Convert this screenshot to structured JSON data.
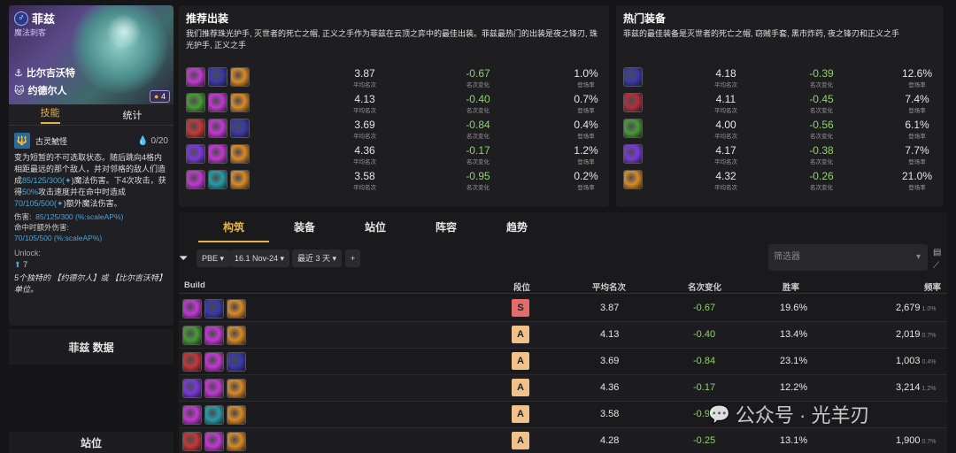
{
  "hero": {
    "name": "菲兹",
    "role": "魔法刺客",
    "trait1": "比尔吉沃特",
    "trait2": "约德尔人",
    "cost": "4"
  },
  "left_tabs": {
    "skill": "技能",
    "stats": "统计"
  },
  "skill": {
    "name": "古灵鯱怪",
    "mana": "0/20",
    "desc_part1": "变为短暂的不可选取状态。随后跳向4格内相距最远的那个敌人，并对邻格的敌人们造成",
    "desc_val1": "85/125/300(",
    "desc_part2": ")魔法伤害。下4次攻击，获得",
    "desc_val2": "50%",
    "desc_part3": "攻击速度并在命中时造成",
    "desc_val3": "70/105/500(",
    "desc_part4": ")额外魔法伤害。",
    "dmg_label": "伤害:",
    "dmg_val": "85/125/300 (%:scaleAP%)",
    "extra_label": "命中时额外伤害:",
    "extra_val": "70/105/500 (%:scaleAP%)",
    "unlock_label": "Unlock:",
    "unlock_count": "7",
    "unlock_desc": "5个独特的 【约德尔人】或 【比尔吉沃特】单位。"
  },
  "left_blocks": {
    "data": "菲兹 数据",
    "position": "站位"
  },
  "recommend": {
    "title": "推荐出装",
    "intro": "我们推荐珠光护手, 灭世者的死亡之帽, 正义之手作为菲兹在云顶之弈中的最佳出装。菲兹最热门的出装是夜之锋刃, 珠光护手, 正义之手",
    "sub_avg": "平均名次",
    "sub_change": "名次变化",
    "sub_rate": "登场率",
    "rows": [
      {
        "avg": "3.87",
        "change": "-0.67",
        "rate": "1.0%",
        "items": [
          "#c03ad0",
          "#3a3aa8",
          "#d88a2a"
        ]
      },
      {
        "avg": "4.13",
        "change": "-0.40",
        "rate": "0.7%",
        "items": [
          "#4a9a3a",
          "#c03ad0",
          "#d88a2a"
        ]
      },
      {
        "avg": "3.69",
        "change": "-0.84",
        "rate": "0.4%",
        "items": [
          "#c23a3a",
          "#c03ad0",
          "#3a3aa8"
        ]
      },
      {
        "avg": "4.36",
        "change": "-0.17",
        "rate": "1.2%",
        "items": [
          "#7a3ad8",
          "#c03ad0",
          "#d88a2a"
        ]
      },
      {
        "avg": "3.58",
        "change": "-0.95",
        "rate": "0.2%",
        "items": [
          "#c03ad0",
          "#2a9aa8",
          "#d88a2a"
        ]
      }
    ]
  },
  "hot": {
    "title": "热门装备",
    "intro": "菲兹的最佳装备是灭世者的死亡之帽, 窃贼手套, 黑市炸药, 夜之锋刃和正义之手",
    "rows": [
      {
        "avg": "4.18",
        "change": "-0.39",
        "rate": "12.6%",
        "color": "#3a3aa8"
      },
      {
        "avg": "4.11",
        "change": "-0.45",
        "rate": "7.4%",
        "color": "#b03040"
      },
      {
        "avg": "4.00",
        "change": "-0.56",
        "rate": "6.1%",
        "color": "#4a9a3a"
      },
      {
        "avg": "4.17",
        "change": "-0.38",
        "rate": "7.7%",
        "color": "#7a3ad8"
      },
      {
        "avg": "4.32",
        "change": "-0.26",
        "rate": "21.0%",
        "color": "#d88a2a"
      }
    ]
  },
  "bottom_tabs": [
    "构筑",
    "装备",
    "站位",
    "阵容",
    "趋势"
  ],
  "filters": {
    "server": "PBE",
    "patch": "16.1 Nov-24",
    "days": "最近 3 天",
    "add": "+",
    "search_placeholder": "筛选器"
  },
  "table": {
    "headers": {
      "build": "Build",
      "tier": "段位",
      "avg": "平均名次",
      "change": "名次变化",
      "win": "胜率",
      "freq": "频率"
    },
    "rows": [
      {
        "tier": "S",
        "avg": "3.87",
        "change": "-0.67",
        "win": "19.6%",
        "freq": "2,679",
        "freq_pct": "1.0%",
        "items": [
          "#c03ad0",
          "#3a3aa8",
          "#d88a2a"
        ]
      },
      {
        "tier": "A",
        "avg": "4.13",
        "change": "-0.40",
        "win": "13.4%",
        "freq": "2,019",
        "freq_pct": "0.7%",
        "items": [
          "#4a9a3a",
          "#c03ad0",
          "#d88a2a"
        ]
      },
      {
        "tier": "A",
        "avg": "3.69",
        "change": "-0.84",
        "win": "23.1%",
        "freq": "1,003",
        "freq_pct": "0.4%",
        "items": [
          "#c23a3a",
          "#c03ad0",
          "#3a3aa8"
        ]
      },
      {
        "tier": "A",
        "avg": "4.36",
        "change": "-0.17",
        "win": "12.2%",
        "freq": "3,214",
        "freq_pct": "1.2%",
        "items": [
          "#7a3ad8",
          "#c03ad0",
          "#d88a2a"
        ]
      },
      {
        "tier": "A",
        "avg": "3.58",
        "change": "-0.95",
        "win": "",
        "freq": "",
        "freq_pct": "",
        "items": [
          "#c03ad0",
          "#2a9aa8",
          "#d88a2a"
        ]
      },
      {
        "tier": "A",
        "avg": "4.28",
        "change": "-0.25",
        "win": "13.1%",
        "freq": "1,900",
        "freq_pct": "0.7%",
        "items": [
          "#c23a3a",
          "#c03ad0",
          "#d88a2a"
        ]
      }
    ]
  },
  "watermark": "公众号 · 光羊刃"
}
